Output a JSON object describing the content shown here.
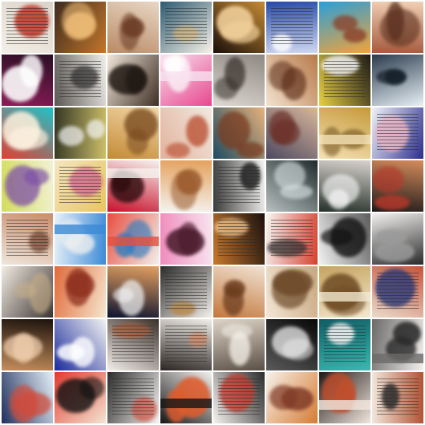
{
  "grid": {
    "rows": 8,
    "cols": 8
  },
  "tiles": [
    {
      "bg": [
        "#f4efe6",
        "#d9d2c9"
      ],
      "blob": "#c43a2b",
      "kind": "doc"
    },
    {
      "bg": [
        "#3d2b1f",
        "#c2762b"
      ],
      "blob": "#f3c27a",
      "kind": "blob"
    },
    {
      "bg": [
        "#b98a66",
        "#e8d7c4"
      ],
      "blob": "#6b3b24",
      "kind": "blob"
    },
    {
      "bg": [
        "#f7f1e7",
        "#2d5a71"
      ],
      "blob": "#e0b86f",
      "kind": "doc"
    },
    {
      "bg": [
        "#1b0f0a",
        "#c48a33"
      ],
      "blob": "#f2d09a",
      "kind": "blob"
    },
    {
      "bg": [
        "#2749a8",
        "#cfd8f0"
      ],
      "blob": "#ffffff",
      "kind": "doc"
    },
    {
      "bg": [
        "#2a9fd8",
        "#f2a33a"
      ],
      "blob": "#8b3f2a",
      "kind": "blob"
    },
    {
      "bg": [
        "#a55a3d",
        "#f1d0b5"
      ],
      "blob": "#5a2f1e",
      "kind": "blob"
    },
    {
      "bg": [
        "#8b1d57",
        "#2a0f24"
      ],
      "blob": "#ffffff",
      "kind": "blob"
    },
    {
      "bg": [
        "#f1eeea",
        "#5a5653"
      ],
      "blob": "#222222",
      "kind": "doc"
    },
    {
      "bg": [
        "#3f2f24",
        "#f1e6da"
      ],
      "blob": "#1a120d",
      "kind": "blob"
    },
    {
      "bg": [
        "#e8478f",
        "#f7e2ef"
      ],
      "blob": "#ffffff",
      "kind": "band"
    },
    {
      "bg": [
        "#8e8883",
        "#ded8d2"
      ],
      "blob": "#3a332e",
      "kind": "blob"
    },
    {
      "bg": [
        "#b77a4a",
        "#f3e2cf"
      ],
      "blob": "#5a2c17",
      "kind": "blob"
    },
    {
      "bg": [
        "#1d1a16",
        "#e8d043"
      ],
      "blob": "#f2f2f2",
      "kind": "doc"
    },
    {
      "bg": [
        "#e7f0f6",
        "#2b3b4c"
      ],
      "blob": "#0f1a24",
      "kind": "blob"
    },
    {
      "bg": [
        "#1ec4c9",
        "#e33d31"
      ],
      "blob": "#fff3e0",
      "kind": "blob"
    },
    {
      "bg": [
        "#333624",
        "#cdbf69"
      ],
      "blob": "#f2f2f2",
      "kind": "blob"
    },
    {
      "bg": [
        "#c48a35",
        "#f2d7a8"
      ],
      "blob": "#7a4b20",
      "kind": "blob"
    },
    {
      "bg": [
        "#f1e8df",
        "#e2b39d"
      ],
      "blob": "#b84a2b",
      "kind": "blob"
    },
    {
      "bg": [
        "#1d4b61",
        "#e6b27c"
      ],
      "blob": "#7a3a1f",
      "kind": "blob"
    },
    {
      "bg": [
        "#4d4960",
        "#d9b79c"
      ],
      "blob": "#6b2f27",
      "kind": "blob"
    },
    {
      "bg": [
        "#c69a3b",
        "#f5e2b6"
      ],
      "blob": "#7b5a23",
      "kind": "band"
    },
    {
      "bg": [
        "#2a2d8d",
        "#f1f2f7"
      ],
      "blob": "#e7b3c6",
      "kind": "doc"
    },
    {
      "bg": [
        "#d3dd5b",
        "#f3f1d6"
      ],
      "blob": "#7d4fa7",
      "kind": "blob"
    },
    {
      "bg": [
        "#e7c55f",
        "#f5e6c0"
      ],
      "blob": "#d04f92",
      "kind": "doc"
    },
    {
      "bg": [
        "#c7122c",
        "#f6f1ee"
      ],
      "blob": "#2d0b0d",
      "kind": "band"
    },
    {
      "bg": [
        "#f5f2ee",
        "#e4a15d"
      ],
      "blob": "#9a5a2c",
      "kind": "blob"
    },
    {
      "bg": [
        "#f3f2f0",
        "#3a3a3a"
      ],
      "blob": "#121212",
      "kind": "doc"
    },
    {
      "bg": [
        "#1f2a2a",
        "#b9c1c1"
      ],
      "blob": "#d8e2e2",
      "kind": "blob"
    },
    {
      "bg": [
        "#25312b",
        "#d8d3cc"
      ],
      "blob": "#f5f5f5",
      "kind": "blob"
    },
    {
      "bg": [
        "#1b1a19",
        "#d58b5c"
      ],
      "blob": "#b5382b",
      "kind": "blob"
    },
    {
      "bg": [
        "#efe6dc",
        "#c98c6a"
      ],
      "blob": "#6f3f2b",
      "kind": "doc"
    },
    {
      "bg": [
        "#e8f1f8",
        "#3b8ad6"
      ],
      "blob": "#f0f0f0",
      "kind": "band"
    },
    {
      "bg": [
        "#f2f0ed",
        "#e84d3f"
      ],
      "blob": "#2b7cc0",
      "kind": "band"
    },
    {
      "bg": [
        "#f08cbd",
        "#f7e4ef"
      ],
      "blob": "#4a1b2c",
      "kind": "blob"
    },
    {
      "bg": [
        "#1a0f0b",
        "#c9792e"
      ],
      "blob": "#f2c78e",
      "kind": "doc"
    },
    {
      "bg": [
        "#f7f4f0",
        "#d4402f"
      ],
      "blob": "#2a2a2a",
      "kind": "doc"
    },
    {
      "bg": [
        "#f2f2f2",
        "#5c5c5c"
      ],
      "blob": "#111111",
      "kind": "blob"
    },
    {
      "bg": [
        "#f3f1ef",
        "#2a2a2a"
      ],
      "blob": "#9b9b9b",
      "kind": "blob"
    },
    {
      "bg": [
        "#f3ece3",
        "#3a3431"
      ],
      "blob": "#c6ae89",
      "kind": "blob"
    },
    {
      "bg": [
        "#f6e6cf",
        "#e06a39"
      ],
      "blob": "#8e2f1e",
      "kind": "blob"
    },
    {
      "bg": [
        "#0c1330",
        "#e4a05f"
      ],
      "blob": "#f0f0f0",
      "kind": "blob"
    },
    {
      "bg": [
        "#f4efe9",
        "#2b2b2b"
      ],
      "blob": "#b7884f",
      "kind": "doc"
    },
    {
      "bg": [
        "#f0e2d2",
        "#c3773c"
      ],
      "blob": "#6a3a1c",
      "kind": "blob"
    },
    {
      "bg": [
        "#f3e6d4",
        "#c8a77f"
      ],
      "blob": "#6d4a2a",
      "kind": "blob"
    },
    {
      "bg": [
        "#c6a35f",
        "#f3e9d0"
      ],
      "blob": "#6e4a22",
      "kind": "band"
    },
    {
      "bg": [
        "#eadbcb",
        "#c7533a"
      ],
      "blob": "#2d3b7a",
      "kind": "doc"
    },
    {
      "bg": [
        "#1c120d",
        "#c58e5c"
      ],
      "blob": "#f4d3b2",
      "kind": "blob"
    },
    {
      "bg": [
        "#1a2b9b",
        "#f2f2f2"
      ],
      "blob": "#ffffff",
      "kind": "blob"
    },
    {
      "bg": [
        "#f3eee9",
        "#3a3029"
      ],
      "blob": "#b05b36",
      "kind": "doc"
    },
    {
      "bg": [
        "#f1ede7",
        "#2a2522"
      ],
      "blob": "#d08b6a",
      "kind": "doc"
    },
    {
      "bg": [
        "#ddd3c6",
        "#5b5046"
      ],
      "blob": "#f4efe8",
      "kind": "blob"
    },
    {
      "bg": [
        "#070707",
        "#5a5a5a"
      ],
      "blob": "#e8e8e8",
      "kind": "blob"
    },
    {
      "bg": [
        "#0f5d63",
        "#3bb8b1"
      ],
      "blob": "#f2f2f2",
      "kind": "doc"
    },
    {
      "bg": [
        "#f3f0ee",
        "#6b6a69"
      ],
      "blob": "#2a2a2a",
      "kind": "band"
    },
    {
      "bg": [
        "#1f2f5c",
        "#e3eef7"
      ],
      "blob": "#d24b3a",
      "kind": "blob"
    },
    {
      "bg": [
        "#e23a2e",
        "#f4e4d2"
      ],
      "blob": "#111111",
      "kind": "blob"
    },
    {
      "bg": [
        "#f6f4f1",
        "#2b2b2b"
      ],
      "blob": "#d04a3a",
      "kind": "doc"
    },
    {
      "bg": [
        "#f2efec",
        "#151515"
      ],
      "blob": "#e05c2d",
      "kind": "band"
    },
    {
      "bg": [
        "#f5f2ef",
        "#2c2c2c"
      ],
      "blob": "#c73a2e",
      "kind": "doc"
    },
    {
      "bg": [
        "#f7f1ea",
        "#d67b33"
      ],
      "blob": "#7f3a26",
      "kind": "blob"
    },
    {
      "bg": [
        "#1f1716",
        "#f2e7de"
      ],
      "blob": "#c24e2b",
      "kind": "band"
    },
    {
      "bg": [
        "#f1e6da",
        "#b25234"
      ],
      "blob": "#272727",
      "kind": "doc"
    }
  ]
}
